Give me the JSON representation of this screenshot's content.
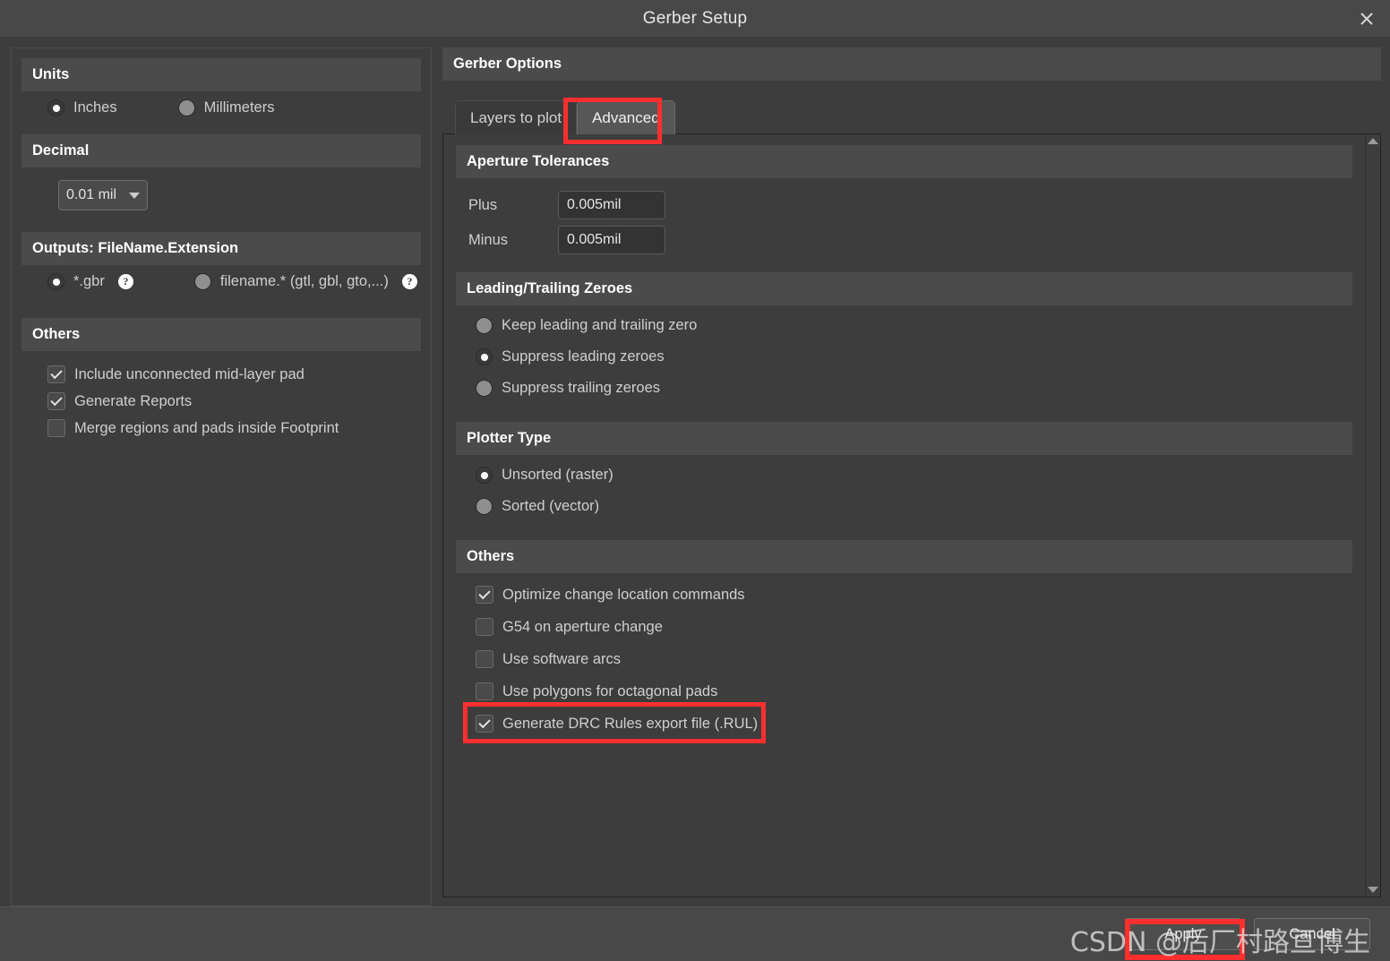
{
  "window": {
    "title": "Gerber Setup",
    "close_icon": "close-icon"
  },
  "left": {
    "units": {
      "header": "Units",
      "options": [
        {
          "label": "Inches",
          "selected": true
        },
        {
          "label": "Millimeters",
          "selected": false
        }
      ]
    },
    "decimal": {
      "header": "Decimal",
      "value": "0.01 mil"
    },
    "outputs": {
      "header": "Outputs: FileName.Extension",
      "options": [
        {
          "label": "*.gbr",
          "selected": true,
          "help": "?"
        },
        {
          "label": "filename.* (gtl, gbl, gto,...)",
          "selected": false,
          "help": "?"
        }
      ]
    },
    "others": {
      "header": "Others",
      "items": [
        {
          "label": "Include unconnected mid-layer pad",
          "checked": true
        },
        {
          "label": "Generate Reports",
          "checked": true
        },
        {
          "label": "Merge regions and pads inside Footprint",
          "checked": false
        }
      ]
    }
  },
  "right": {
    "header": "Gerber Options",
    "tabs": [
      {
        "label": "Layers to plot",
        "active": false
      },
      {
        "label": "Advanced",
        "active": true,
        "highlighted": true
      }
    ],
    "aperture": {
      "header": "Aperture Tolerances",
      "fields": [
        {
          "label": "Plus",
          "value": "0.005mil"
        },
        {
          "label": "Minus",
          "value": "0.005mil"
        }
      ]
    },
    "zeroes": {
      "header": "Leading/Trailing Zeroes",
      "options": [
        {
          "label": "Keep leading and trailing zero",
          "selected": false
        },
        {
          "label": "Suppress leading zeroes",
          "selected": true
        },
        {
          "label": "Suppress trailing zeroes",
          "selected": false
        }
      ]
    },
    "plotter": {
      "header": "Plotter Type",
      "options": [
        {
          "label": "Unsorted (raster)",
          "selected": true
        },
        {
          "label": "Sorted (vector)",
          "selected": false
        }
      ]
    },
    "others": {
      "header": "Others",
      "items": [
        {
          "label": "Optimize change location commands",
          "checked": true,
          "highlighted": false
        },
        {
          "label": "G54 on aperture change",
          "checked": false,
          "highlighted": false
        },
        {
          "label": "Use software arcs",
          "checked": false,
          "highlighted": false
        },
        {
          "label": "Use polygons for octagonal pads",
          "checked": false,
          "highlighted": false
        },
        {
          "label": "Generate DRC Rules export file (.RUL)",
          "checked": true,
          "highlighted": true
        }
      ]
    },
    "scrollbar": {
      "up_icon": "scroll-up-arrow-icon",
      "down_icon": "scroll-down-arrow-icon"
    }
  },
  "footer": {
    "apply_label": "Apply",
    "cancel_label": "Cancel",
    "watermark": "CSDN @后厂村路亘博生"
  },
  "colors": {
    "highlight": "#ff2f2f",
    "window_bg": "#3d3d3d",
    "header_bg": "#4b4b4b",
    "titlebar_bg": "#484848"
  }
}
